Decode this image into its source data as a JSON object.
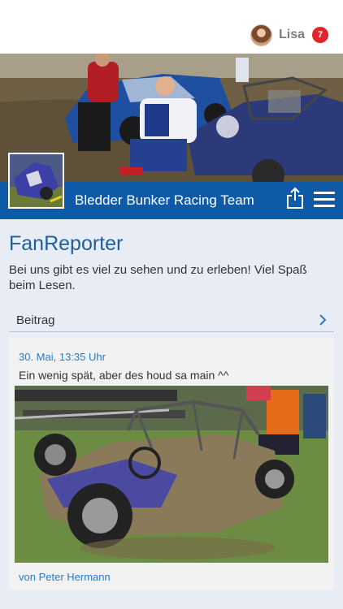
{
  "user": {
    "name": "Lisa",
    "notifications": "7"
  },
  "team": {
    "name": "Bledder Bunker Racing Team"
  },
  "page": {
    "title": "FanReporter",
    "intro": "Bei uns gibt es viel zu sehen und zu erleben! Viel Spaß beim Lesen."
  },
  "section": {
    "label": "Beitrag"
  },
  "post": {
    "date": "30. Mai, 13:35 Uhr",
    "text": "Ein wenig spät, aber des houd sa main ^^",
    "author": "von Peter Hermann"
  },
  "colors": {
    "brand_blue": "#0f5aa8",
    "title_blue": "#1f5e9e",
    "link_blue": "#2c7bbf",
    "badge_red": "#e0262a",
    "background": "#e8edf5"
  },
  "icons": [
    "share-icon",
    "menu-icon",
    "chevron-right-icon",
    "avatar"
  ]
}
